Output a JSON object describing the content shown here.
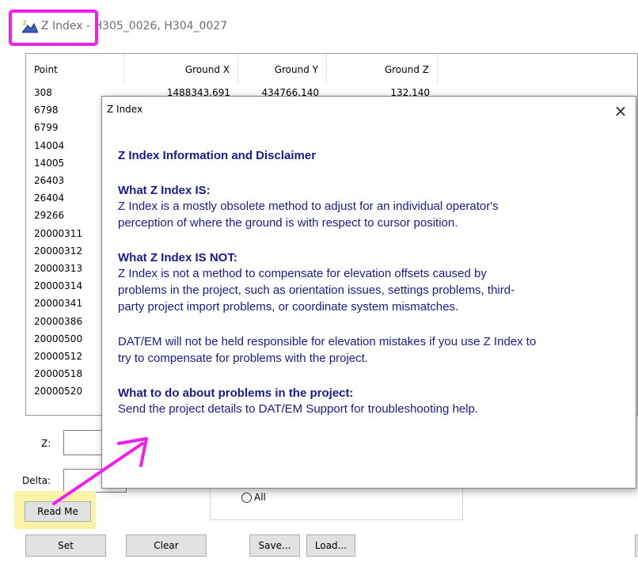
{
  "window": {
    "title": "Z Index - H305_0026, H304_0027"
  },
  "grid": {
    "columns": [
      "Point",
      "Ground X",
      "Ground Y",
      "Ground Z"
    ],
    "first_row": [
      "308",
      "1488343.691",
      "434766.140",
      "132.140"
    ],
    "points": [
      "6798",
      "6799",
      "14004",
      "14005",
      "26403",
      "26404",
      "29266",
      "20000311",
      "20000312",
      "20000313",
      "20000314",
      "20000341",
      "20000386",
      "20000500",
      "20000512",
      "20000518",
      "20000520"
    ]
  },
  "controls": {
    "z_label": "Z:",
    "delta_label": "Delta:",
    "readme_label": "Read Me",
    "radio_all_label": "All",
    "set_label": "Set",
    "clear_label": "Clear",
    "save_label": "Save...",
    "load_label": "Load..."
  },
  "dialog": {
    "title": "Z Index",
    "close_symbol": "×",
    "heading": "Z Index Information and Disclaimer",
    "is_heading": "What Z Index IS:",
    "is_line1": "Z Index is a mostly obsolete method to adjust for an individual operator's",
    "is_line2": "perception of where the ground is with respect to cursor position.",
    "isnot_heading": "What Z Index IS NOT:",
    "isnot_line1": "Z Index is not a method to compensate for elevation offsets caused by",
    "isnot_line2": "problems in the project, such as orientation issues, settings problems, third-",
    "isnot_line3": "party project import problems, or coordinate system mismatches.",
    "disclaimer_line1": "DAT/EM will not be held responsible for elevation mistakes if you use Z Index to",
    "disclaimer_line2": "try to compensate for problems with the project.",
    "todo_heading": "What to do about problems in the project:",
    "todo_line1": "Send the project details to DAT/EM Support for troubleshooting help."
  },
  "annotations": {
    "highlight_color": "#f01ff0",
    "readme_highlight_color": "#fbf4a8"
  }
}
